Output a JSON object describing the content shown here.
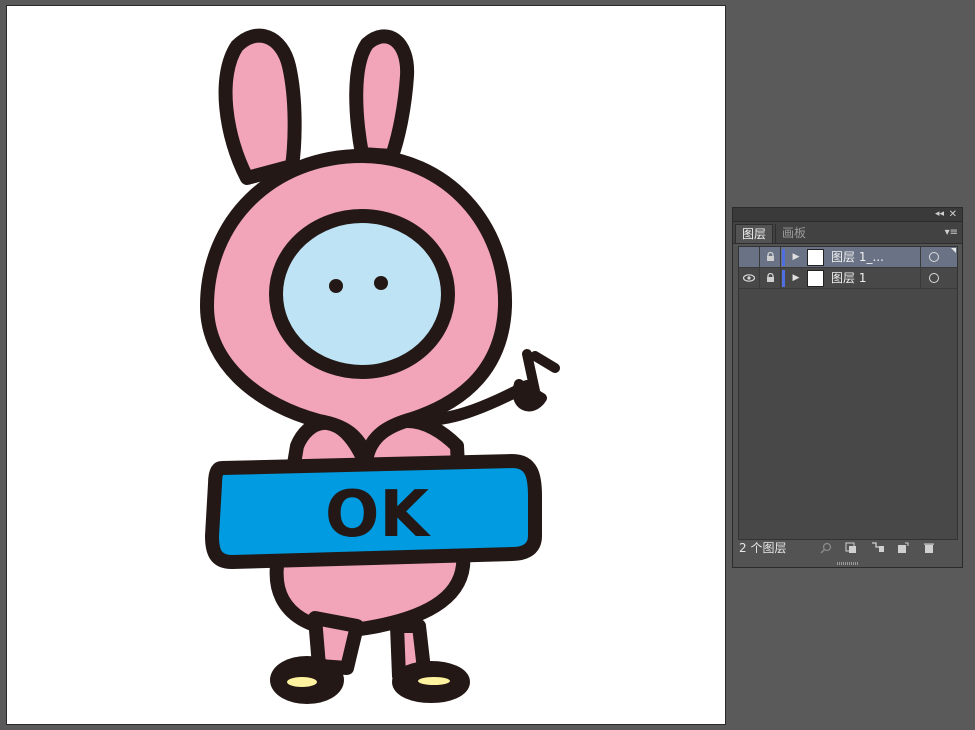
{
  "layers_panel": {
    "tabs": [
      {
        "label": "图层",
        "active": true
      },
      {
        "label": "画板",
        "active": false
      }
    ],
    "layers": [
      {
        "name": "图层 1_...",
        "visible": false,
        "selected": true,
        "color": "#4f6fe0"
      },
      {
        "name": "图层 1",
        "visible": true,
        "selected": false,
        "color": "#4f6fe0"
      }
    ],
    "layer_count": "2 个图层"
  },
  "artwork": {
    "banner_text": "OK",
    "colors": {
      "body": "#f2a5b8",
      "face": "#bde3f4",
      "banner": "#009be1",
      "outline": "#231815",
      "shoe_highlight": "#fff3a0"
    }
  }
}
